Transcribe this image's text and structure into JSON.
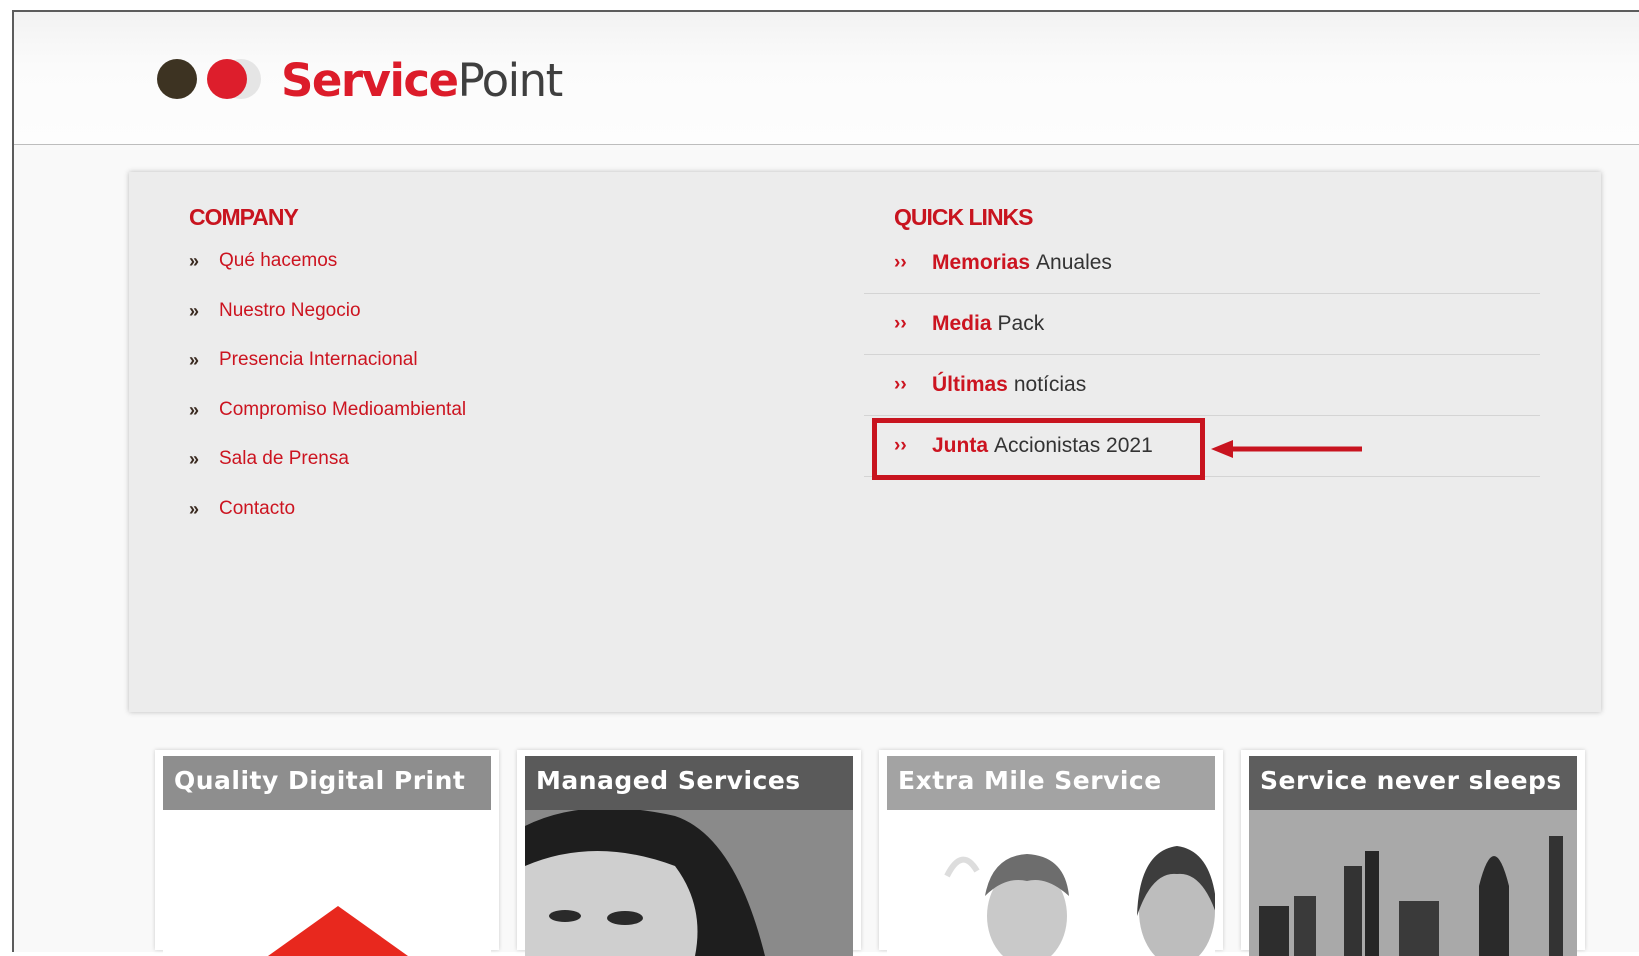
{
  "brand": {
    "service": "Service",
    "point": "Point"
  },
  "company": {
    "title": "COMPANY",
    "bullet": "»",
    "items": [
      "Qué hacemos",
      "Nuestro Negocio",
      "Presencia Internacional",
      "Compromiso Medioambiental",
      "Sala de Prensa",
      "Contacto"
    ]
  },
  "quick_links": {
    "title": "QUICK LINKS",
    "bullet": "››",
    "items": [
      {
        "strong": "Memorias",
        "rest": "Anuales"
      },
      {
        "strong": "Media",
        "rest": "Pack"
      },
      {
        "strong": "Últimas",
        "rest": "notícias"
      },
      {
        "strong": "Junta",
        "rest": "Accionistas 2021"
      }
    ]
  },
  "cards": [
    {
      "title": "Quality Digital Print"
    },
    {
      "title": "Managed Services"
    },
    {
      "title": "Extra Mile Service"
    },
    {
      "title": "Service never sleeps"
    }
  ],
  "colors": {
    "brand_red": "#dc1c2a",
    "link_red": "#cc1420",
    "annotation_red": "#c8141f"
  }
}
